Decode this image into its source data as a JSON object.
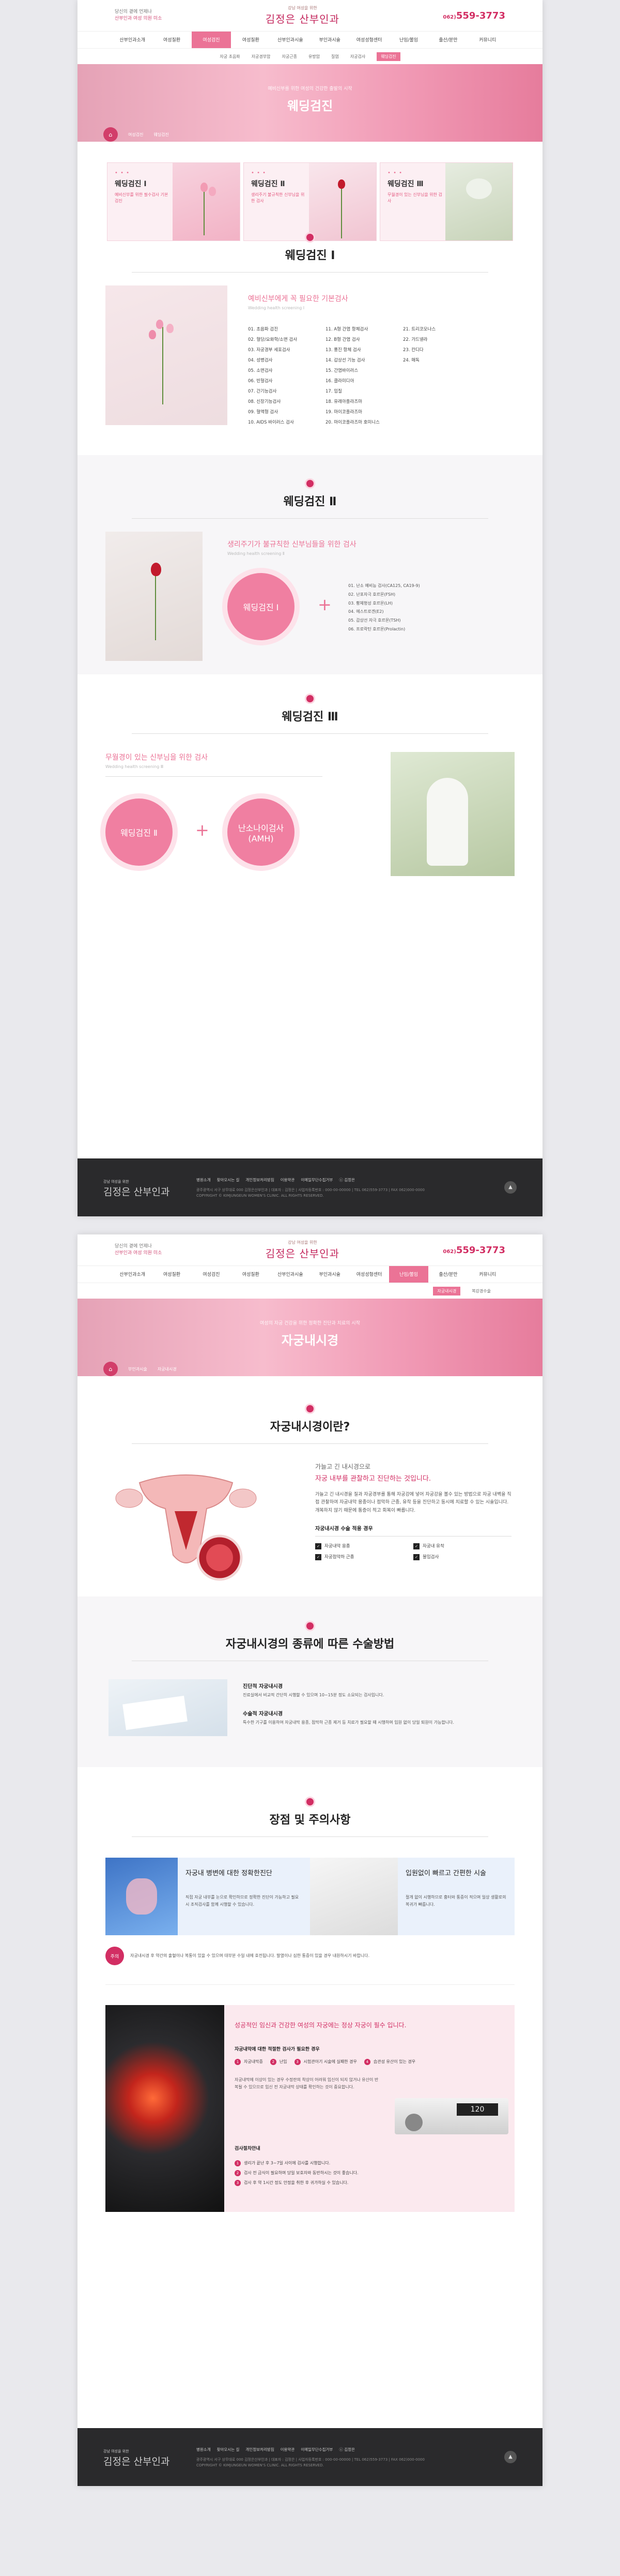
{
  "header": {
    "hdr_line1": "당신의 곁에 언제나",
    "hdr_line2": "산부인과 여성 의원 미소",
    "logo_small": "강남 여성을 위한",
    "logo_text": "김정은 산부인과",
    "phone_small": "062)",
    "phone": "559-3773"
  },
  "gnb": [
    "산부인과소개",
    "여성질환",
    "여성검진",
    "여성질환",
    "산부인과시술",
    "부인과시술",
    "여성성형센터",
    "난임/불임",
    "출산/분만",
    "커뮤니티"
  ],
  "page1": {
    "lnb": [
      "자궁 초음파",
      "자궁경부암",
      "자궁근종",
      "유방암",
      "질염",
      "자궁검사",
      "웨딩검진"
    ],
    "hero_sub": "예비신부를 위한 여성의 건강한 출발의 시작",
    "hero_title": "웨딩검진",
    "breadcrumb_1": "여성검진",
    "breadcrumb_2": "웨딩검진",
    "cards": [
      {
        "title": "웨딩검진 Ⅰ",
        "desc": "예비신부를 위한 필수검사 기본검진"
      },
      {
        "title": "웨딩검진 Ⅱ",
        "desc": "생리주기 불규칙한 신부님을 위한 검사"
      },
      {
        "title": "웨딩검진 Ⅲ",
        "desc": "무월경이 있는 신부님을 위한 검사"
      }
    ],
    "sec1_title": "웨딩검진 Ⅰ",
    "sec1_pink": "예비신부에게 꼭 필요한 기본검사",
    "sec1_en": "Wedding health screening Ⅰ",
    "sec1_items": [
      "01. 초음파 검진",
      "11. A형 간염 항체검사",
      "21. 트리코모나스",
      "02. 혈당/요화학/소변 검사",
      "12. B형 간염 검사",
      "22. 가드넬라",
      "03. 자궁경부 세포검사",
      "13. 풍진 항체 검사",
      "23. 칸디다",
      "04. 성병검사",
      "14. 갑상선 기능 검사",
      "24. 매독",
      "05. 소변검사",
      "15. 간염바이러스",
      "",
      "06. 빈혈검사",
      "16. 클라미디아",
      "",
      "07. 간기능검사",
      "17. 임질",
      "",
      "08. 신장기능검사",
      "18. 유레아플라즈마",
      "",
      "09. 혈액형 검사",
      "19. 마이코플라즈마",
      "",
      "10. AIDS 바이러스 검사",
      "20. 마이코플라즈마 호미니스",
      ""
    ],
    "sec2_title": "웨딩검진 Ⅱ",
    "sec2_pink": "생리주기가 불규칙한 신부님들을 위한 검사",
    "sec2_en": "Wedding health screening Ⅱ",
    "sec2_circle": "웨딩검진 Ⅰ",
    "sec2_items": [
      "01. 난소 예비능 검사(CA125, CA19-9)",
      "02. 난포자극 호르몬(FSH)",
      "03. 황체형성 호르몬(LH)",
      "04. 에스트로겐(E2)",
      "05. 갑상선 자극 호르몬(TSH)",
      "06. 프로락틴 호르몬(Prolactin)"
    ],
    "sec3_title": "웨딩검진 Ⅲ",
    "sec3_pink": "무월경이 있는 신부님을 위한 검사",
    "sec3_en": "Wedding health screening Ⅲ",
    "sec3_circle1": "웨딩검진 Ⅱ",
    "sec3_circle2": "난소나이검사 (AMH)"
  },
  "footer": {
    "logo_small": "강남 여성을 위한",
    "logo_text": "김정은 산부인과",
    "links": [
      "병원소개",
      "찾아오시는 길",
      "개인정보처리방침",
      "이용약관",
      "이메일무단수집거부",
      "ⓒ 김정은"
    ],
    "info": "광주광역시 서구 상무대로 000 김정은산부인과  |  대표자 : 김정은  |  사업자등록번호 : 000-00-00000  |  TEL 062)559-3773  |  FAX 062)000-0000",
    "copyright": "COPYRIGHT © KIMJUNGEUN WOMEN'S CLINIC. ALL RIGHTS RESERVED.",
    "top": "▲"
  },
  "page2": {
    "lnb": [
      "자궁내시경",
      "복강경수술"
    ],
    "hero_sub": "여성의 자궁 건강을 위한 정확한 진단과 치료의 시작",
    "hero_title": "자궁내시경",
    "breadcrumb_1": "부인과시술",
    "breadcrumb_2": "자궁내시경",
    "s1_title": "자궁내시경이란?",
    "s1_lead1": "가늘고 긴 내시경으로",
    "s1_lead2": "자궁 내부를 관찰하고 진단하는 것입니다.",
    "s1_body": "가늘고 긴 내시경을 질과 자궁경부를 통해 자궁강에 넣어 자궁강을 볼수 있는 방법으로 자궁 내벽을 직접 관찰하여 자궁내막 용종이나 점막하 근종, 유착 등을 진단하고 동시에 치료할 수 있는 시술입니다. 개복하지 않기 때문에 통증이 적고 회복이 빠릅니다.",
    "s1_case_title": "자궁내시경 수술 적용 경우",
    "s1_cases": [
      "자궁내막 용종",
      "자궁내 유착",
      "자궁점막하 근종",
      "불임검사"
    ],
    "s2_title": "자궁내시경의 종류에 따른 수술방법",
    "s2_a_title": "진단적 자궁내시경",
    "s2_a_body": "진료실에서 비교적 간단히 시행할 수 있으며 10~15분 정도 소요되는 검사입니다.",
    "s2_b_title": "수술적 자궁내시경",
    "s2_b_body": "특수한 기구를 이용하여 자궁내막 용종, 점막하 근종 제거 등 치료가 필요할 때 시행하며 입원 없이 당일 퇴원이 가능합니다.",
    "s3_title": "장점 및 주의사항",
    "s3_box1_title": "자궁내 병변에 대한 정확한진단",
    "s3_box1_body": "직접 자궁 내부를 눈으로 확인하므로 정확한 진단이 가능하고 필요시 조직검사를 함께 시행할 수 있습니다.",
    "s3_box2_title": "입원없이 빠르고 간편한 시술",
    "s3_box2_body": "절개 없이 시행하므로 흉터와 통증이 적으며 일상 생활로의 복귀가 빠릅니다.",
    "s3_note_badge": "주의",
    "s3_note": "자궁내시경 후 약간의 출혈이나 복통이 있을 수 있으며 대부분 수일 내에 호전됩니다. 발열이나 심한 통증이 있을 경우 내원하시기 바랍니다.",
    "s4_lead": "성공적인 임신과 건강한 여성의 자궁에는 정상 자궁이 필수 입니다.",
    "s4_list_title": "자궁내막에 대한 적절한 검사가 필요한 경우",
    "s4_tags": [
      "자궁내막증",
      "난임",
      "시험관아기 시술에 실패한 경우",
      "습관성 유산이 있는 경우"
    ],
    "s4_body": "자궁내막에 이상이 있는 경우 수정란의 착상이 어려워 임신이 되지 않거나 유산이 반복될 수 있으므로 임신 전 자궁내막 상태를 확인하는 것이 중요합니다.",
    "s4_prep_title": "검사절차안내",
    "s4_steps": [
      "생리가 끝난 후 3~7일 사이에 검사를 시행합니다.",
      "검사 전 금식이 필요하며 당일 보호자와 동반하시는 것이 좋습니다.",
      "검사 후 약 1시간 정도 안정을 취한 후 귀가하실 수 있습니다."
    ],
    "device_display": "120"
  }
}
